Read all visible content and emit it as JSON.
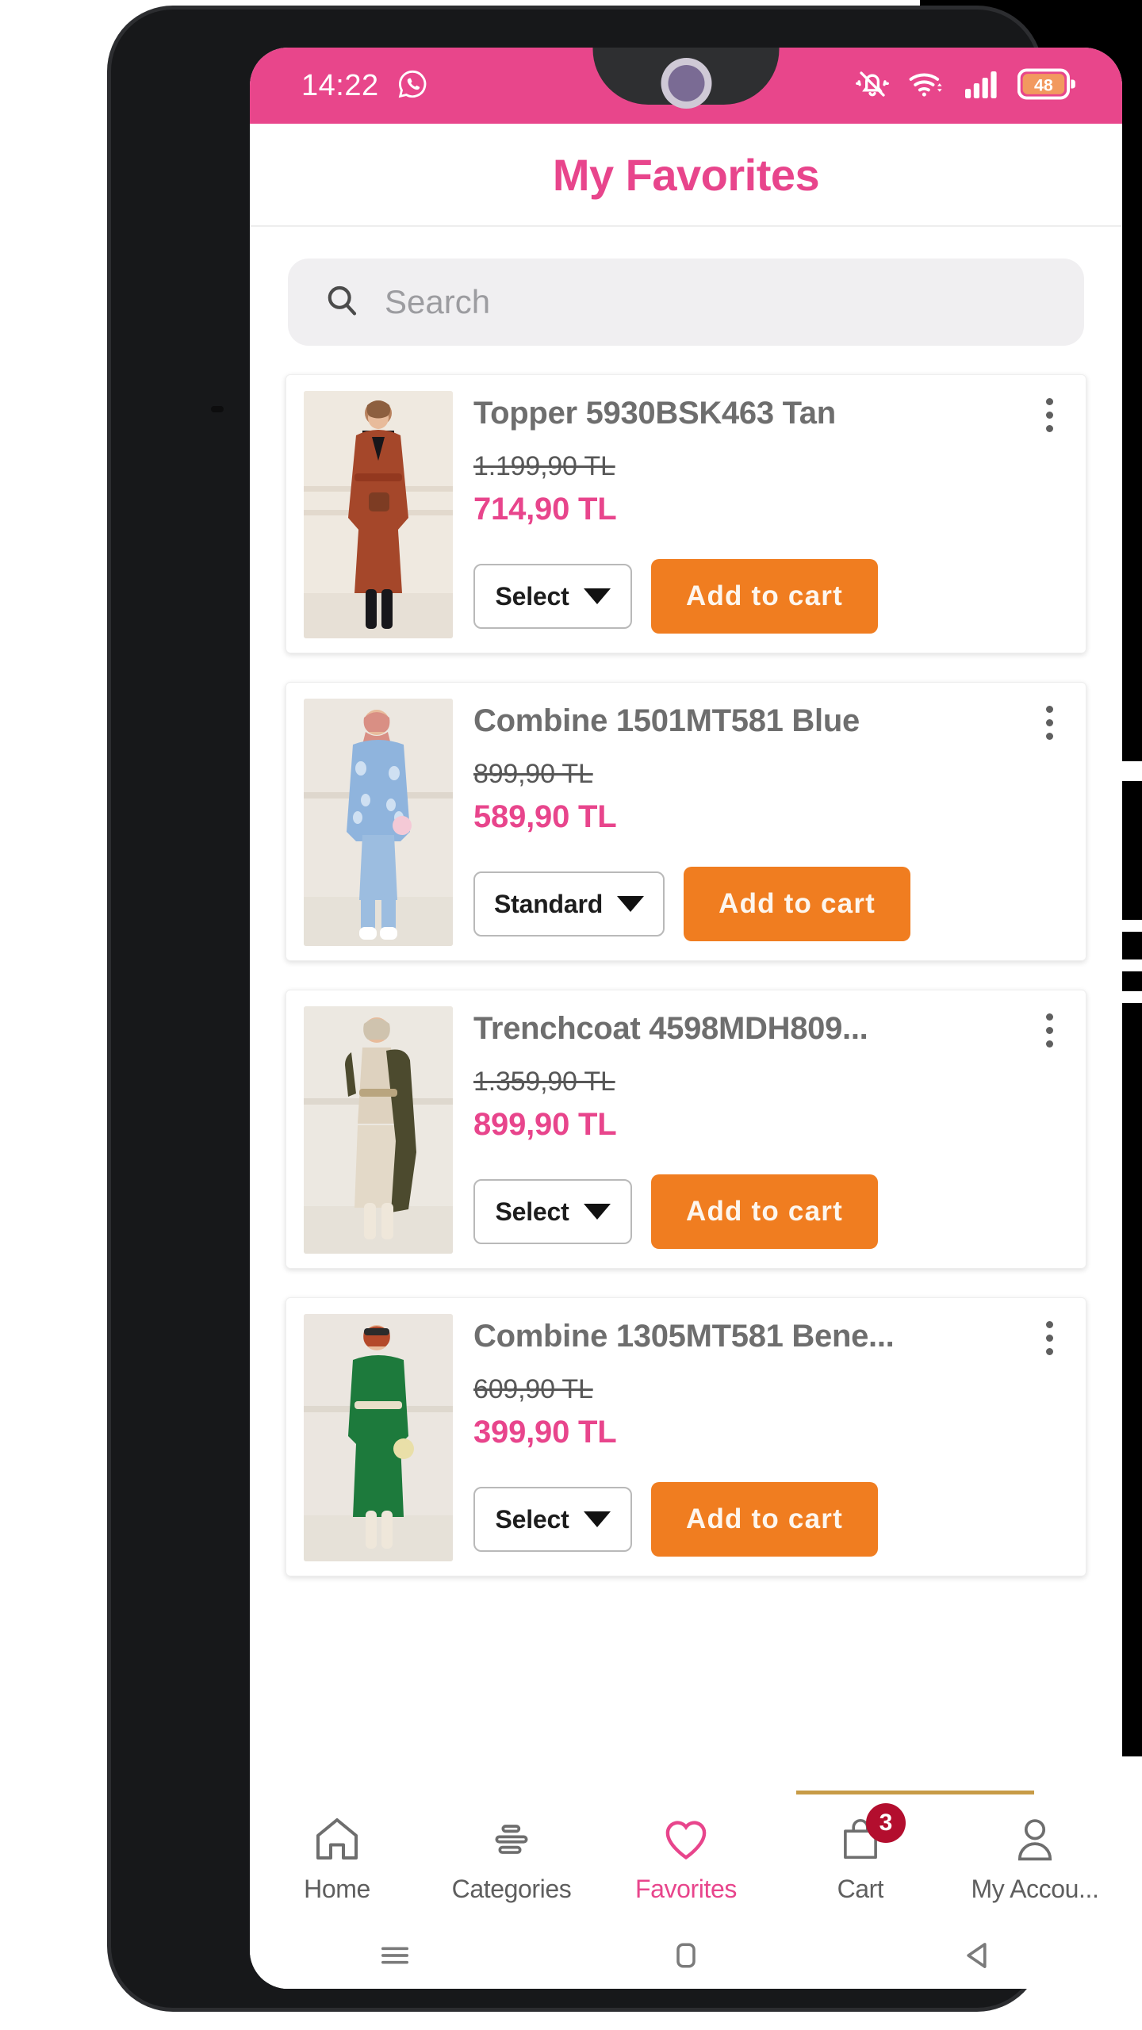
{
  "status_bar": {
    "time": "14:22",
    "icons": [
      "whatsapp-icon",
      "mute-bell-icon",
      "wifi-icon",
      "signal-icon",
      "battery-icon"
    ],
    "battery_level": "48",
    "background_color": "#e8468b"
  },
  "header": {
    "title": "My Favorites",
    "title_color": "#e8458c"
  },
  "search": {
    "placeholder": "Search",
    "value": "",
    "icon": "search-icon"
  },
  "theme": {
    "accent_pink": "#e8458c",
    "cart_orange": "#f07d20",
    "badge_red": "#b30e2e",
    "gold_rule": "#c79b46"
  },
  "products": [
    {
      "title": "Topper 5930BSK463 Tan",
      "old_price": "1.199,90 TL",
      "new_price": "714,90 TL",
      "select_label": "Select",
      "add_to_cart_label": "Add to cart",
      "menu_icon": "kebab-menu-icon",
      "image_alt": "Woman in tan long coat",
      "image_colors": {
        "garment": "#a5472a",
        "bg": "#efe7dd",
        "inner": "#17161a"
      }
    },
    {
      "title": "Combine 1501MT581 Blue",
      "old_price": "899,90 TL",
      "new_price": "589,90 TL",
      "select_label": "Standard",
      "add_to_cart_label": "Add to cart",
      "menu_icon": "kebab-menu-icon",
      "image_alt": "Woman in blue patterned kimono set",
      "image_colors": {
        "garment": "#8fb4dd",
        "bg": "#ece7e2",
        "inner": "#c7d9ef"
      }
    },
    {
      "title": "Trenchcoat 4598MDH809...",
      "old_price": "1.359,90 TL",
      "new_price": "899,90 TL",
      "select_label": "Select",
      "add_to_cart_label": "Add to cart",
      "menu_icon": "kebab-menu-icon",
      "image_alt": "Woman in khaki trenchcoat over cream outfit",
      "image_colors": {
        "garment": "#4c4a2e",
        "bg": "#ece8e1",
        "inner": "#ded2bf"
      }
    },
    {
      "title": "Combine 1305MT581 Bene...",
      "old_price": "609,90 TL",
      "new_price": "399,90 TL",
      "select_label": "Select",
      "add_to_cart_label": "Add to cart",
      "menu_icon": "kebab-menu-icon",
      "image_alt": "Woman in green dress",
      "image_colors": {
        "garment": "#1d7a3c",
        "bg": "#ebe6e0",
        "inner": "#e8e3da"
      }
    }
  ],
  "bottom_nav": [
    {
      "label": "Home",
      "icon": "home-icon",
      "active": false
    },
    {
      "label": "Categories",
      "icon": "categories-icon",
      "active": false
    },
    {
      "label": "Favorites",
      "icon": "heart-icon",
      "active": true
    },
    {
      "label": "Cart",
      "icon": "bag-icon",
      "active": false,
      "badge": "3"
    },
    {
      "label": "My Accou...",
      "icon": "person-icon",
      "active": false
    }
  ],
  "system_nav": [
    {
      "name": "recents-button",
      "icon": "hamburger-icon"
    },
    {
      "name": "home-button",
      "icon": "square-icon"
    },
    {
      "name": "back-button",
      "icon": "triangle-left-icon"
    }
  ]
}
